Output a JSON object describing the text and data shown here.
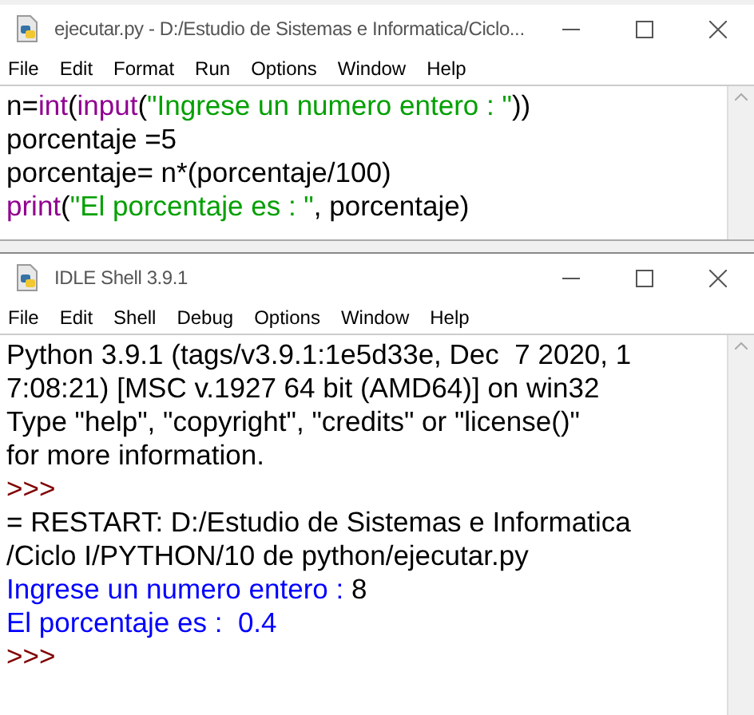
{
  "editor": {
    "title": "ejecutar.py - D:/Estudio de Sistemas e Informatica/Ciclo...",
    "menu": [
      "File",
      "Edit",
      "Format",
      "Run",
      "Options",
      "Window",
      "Help"
    ],
    "lines": [
      [
        {
          "kind": "plain",
          "text": "n="
        },
        {
          "kind": "builtin",
          "text": "int"
        },
        {
          "kind": "plain",
          "text": "("
        },
        {
          "kind": "builtin",
          "text": "input"
        },
        {
          "kind": "plain",
          "text": "("
        },
        {
          "kind": "string",
          "text": "\"Ingrese un numero entero : \""
        },
        {
          "kind": "plain",
          "text": "))"
        }
      ],
      [
        {
          "kind": "plain",
          "text": "porcentaje =5"
        }
      ],
      [
        {
          "kind": "plain",
          "text": "porcentaje= n*(porcentaje/100)"
        }
      ],
      [
        {
          "kind": "builtin",
          "text": "print"
        },
        {
          "kind": "plain",
          "text": "("
        },
        {
          "kind": "string",
          "text": "\"El porcentaje es : \""
        },
        {
          "kind": "plain",
          "text": ", porcentaje)"
        }
      ]
    ]
  },
  "shell": {
    "title": "IDLE Shell 3.9.1",
    "menu": [
      "File",
      "Edit",
      "Shell",
      "Debug",
      "Options",
      "Window",
      "Help"
    ],
    "lines": [
      [
        {
          "kind": "plain",
          "text": "Python 3.9.1 (tags/v3.9.1:1e5d33e, Dec  7 2020, 1"
        }
      ],
      [
        {
          "kind": "plain",
          "text": "7:08:21) [MSC v.1927 64 bit (AMD64)] on win32"
        }
      ],
      [
        {
          "kind": "plain",
          "text": "Type \"help\", \"copyright\", \"credits\" or \"license()\""
        }
      ],
      [
        {
          "kind": "plain",
          "text": "for more information."
        }
      ],
      [
        {
          "kind": "prompt",
          "text": ">>>"
        }
      ],
      [
        {
          "kind": "plain",
          "text": "= RESTART: D:/Estudio de Sistemas e Informatica"
        }
      ],
      [
        {
          "kind": "plain",
          "text": "/Ciclo I/PYTHON/10 de python/ejecutar.py"
        }
      ],
      [
        {
          "kind": "stdout",
          "text": "Ingrese un numero entero : "
        },
        {
          "kind": "plain",
          "text": "8"
        }
      ],
      [
        {
          "kind": "stdout",
          "text": "El porcentaje es :  0.4"
        }
      ],
      [
        {
          "kind": "prompt",
          "text": ">>>"
        }
      ]
    ]
  }
}
